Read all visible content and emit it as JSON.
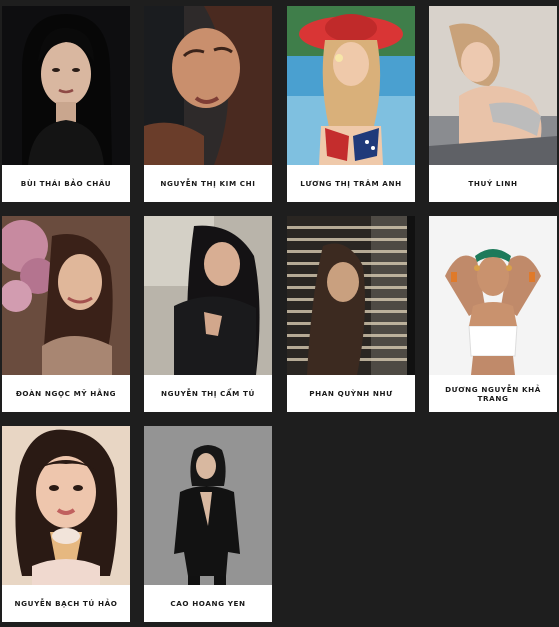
{
  "models": [
    {
      "name": "BÙI THÁI BẢO CHÂU",
      "photo": "portrait-dark-hair-black-top"
    },
    {
      "name": "NGUYỄN THỊ KIM CHI",
      "photo": "portrait-closeup-warm-light"
    },
    {
      "name": "LƯƠNG THỊ TRÂM ANH",
      "photo": "portrait-red-hat-flag-swimsuit"
    },
    {
      "name": "THUÝ LINH",
      "photo": "portrait-reclining-white-background"
    },
    {
      "name": "ĐOÀN NGỌC MỸ HẰNG",
      "photo": "portrait-flower-headpiece"
    },
    {
      "name": "NGUYỄN THỊ CẨM TÚ",
      "photo": "portrait-black-outfit-window"
    },
    {
      "name": "PHAN QUỲNH NHƯ",
      "photo": "portrait-blinds-shadow"
    },
    {
      "name": "DƯƠNG NGUYỄN KHẢ TRANG",
      "photo": "portrait-white-top-headscarf"
    },
    {
      "name": "NGUYỄN BẠCH TÚ HẢO",
      "photo": "portrait-curly-hair-ice-cream"
    },
    {
      "name": "CAO HOANG YEN",
      "photo": "portrait-black-blazer-grey-background"
    }
  ]
}
